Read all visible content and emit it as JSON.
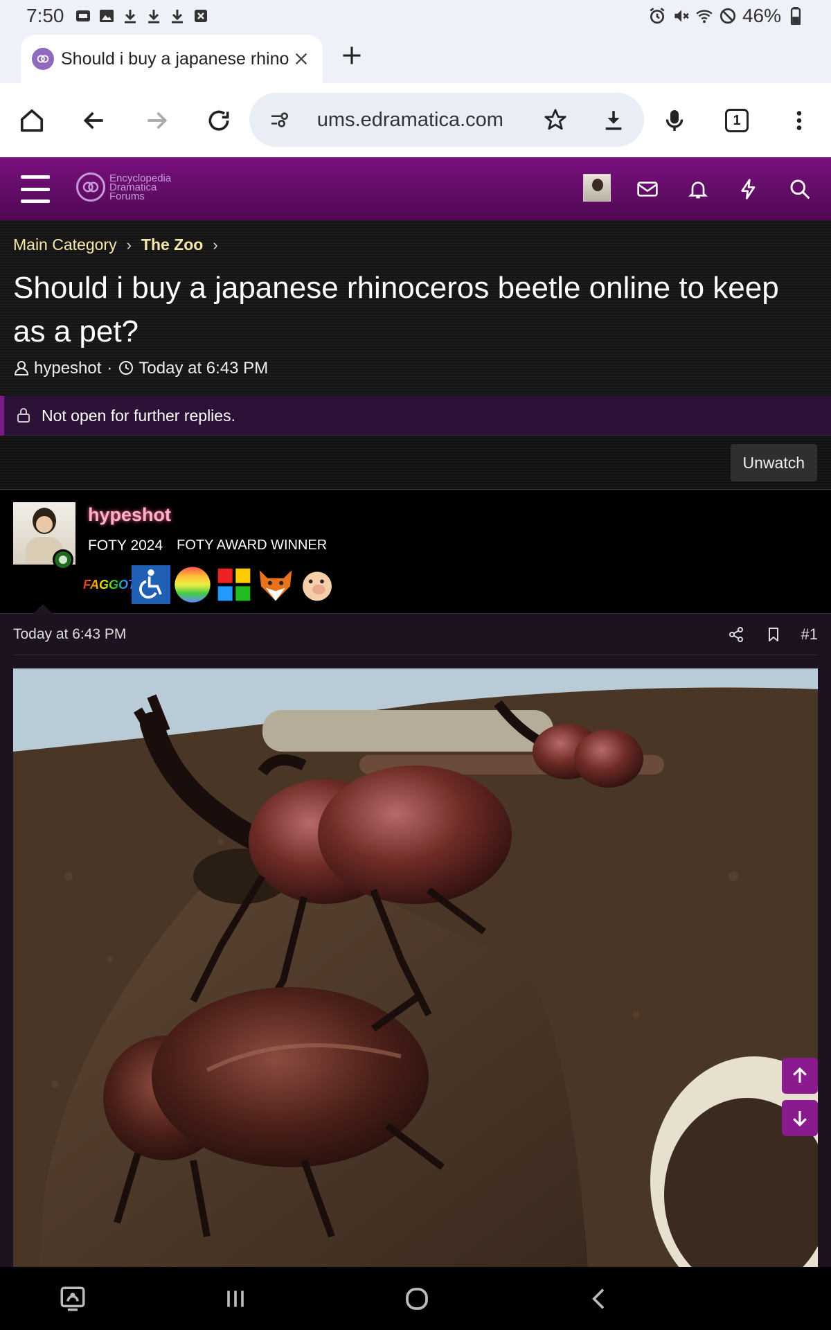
{
  "status_bar": {
    "time": "7:50",
    "battery": "46%",
    "left_icons": [
      "screenshot-icon",
      "image-icon",
      "download-icon",
      "download-icon",
      "download-icon",
      "close-box-icon"
    ],
    "right_icons": [
      "alarm-icon",
      "mute-icon",
      "wifi-icon",
      "do-not-disturb-icon",
      "battery-icon"
    ]
  },
  "browser": {
    "tab_title": "Should i buy a japanese rhinoceros beetle online to keep as a pet?",
    "url": "ums.edramatica.com",
    "tab_count": "1"
  },
  "site": {
    "logo_lines": [
      "Encyclopedia",
      "Dramatica",
      "Forums"
    ],
    "accent_color": "#7a117e"
  },
  "breadcrumb": {
    "items": [
      "Main Category",
      "The Zoo"
    ]
  },
  "thread": {
    "title": "Should i buy a japanese rhinoceros beetle online to keep as a pet?",
    "author": "hypeshot",
    "meta_separator": "·",
    "date": "Today at 6:43 PM",
    "locked_notice": "Not open for further replies.",
    "unwatch_label": "Unwatch"
  },
  "user": {
    "name": "hypeshot",
    "title_1": "FOTY 2024",
    "title_2": "FOTY AWARD WINNER",
    "badges": [
      "FAGGOT",
      "wheelchair-badge",
      "rainbow-ball-badge",
      "puzzle-piece-badge",
      "fox-badge",
      "pig-badge"
    ]
  },
  "post": {
    "date": "Today at 6:43 PM",
    "number": "#1",
    "image_subject": "rhinoceros-beetles-image"
  }
}
